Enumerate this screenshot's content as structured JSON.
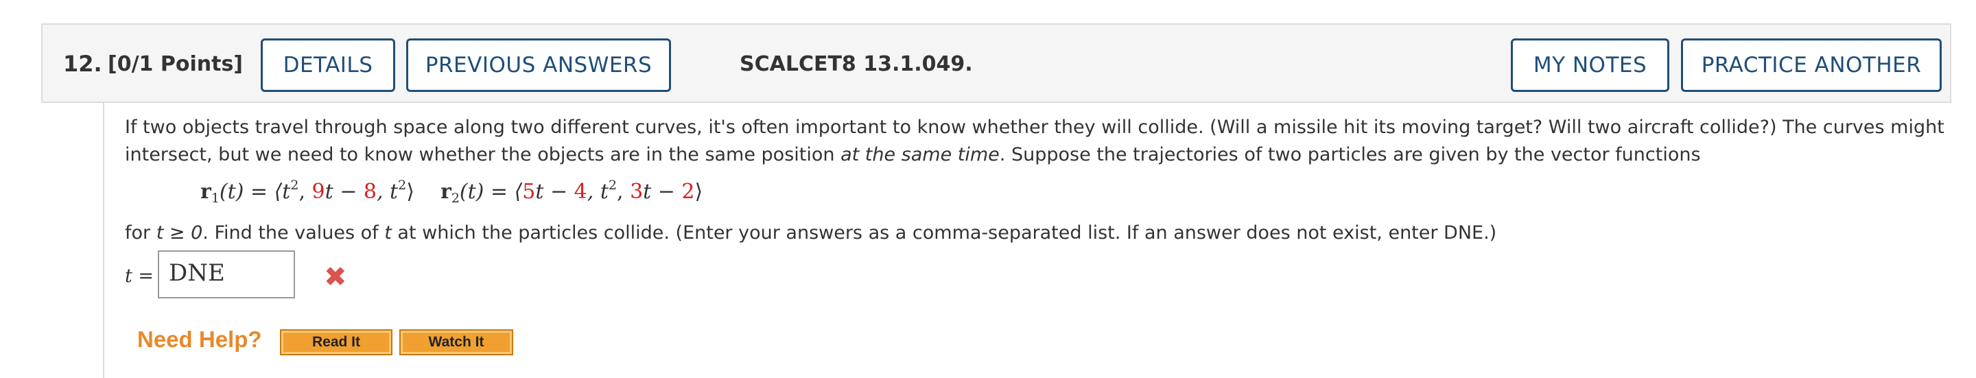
{
  "header": {
    "question_number": "12.",
    "points": "[0/1 Points]",
    "details_label": "DETAILS",
    "previous_answers_label": "PREVIOUS ANSWERS",
    "question_id": "SCALCET8 13.1.049.",
    "my_notes_label": "MY NOTES",
    "practice_another_label": "PRACTICE ANOTHER"
  },
  "question": {
    "para1_line1": "If two objects travel through space along two different curves, it's often important to know whether they will collide. (Will a missile hit its moving target? Will two aircraft collide?) The curves might",
    "para1_line2_start": "intersect, but we need to know whether the objects are in the same position ",
    "para1_line2_italic": "at the same time",
    "para1_line2_end": ". Suppose the trajectories of two particles are given by the vector functions",
    "r1": {
      "name": "r",
      "sub": "1",
      "arg": "(t) = ⟨t",
      "exp1": "2",
      "sep1": ", ",
      "red1": "9",
      "mid1": "t − ",
      "red2": "8",
      "sep2": ", t",
      "exp2": "2",
      "close": "⟩"
    },
    "r2": {
      "name": "r",
      "sub": "2",
      "arg": "(t) = ⟨",
      "red1": "5",
      "mid1": "t − ",
      "red2": "4",
      "sep1": ", t",
      "exp1": "2",
      "sep2": ", ",
      "red3": "3",
      "mid2": "t − ",
      "red4": "2",
      "close": "⟩"
    },
    "para2_for": "for  ",
    "para2_cond": "t ≥ 0",
    "para2_mid": ".  Find the values of ",
    "para2_t": "t",
    "para2_end": " at which the particles collide. (Enter your answers as a comma-separated list. If an answer does not exist, enter DNE.)"
  },
  "answer": {
    "label": "t =",
    "value": "DNE",
    "status": "incorrect",
    "status_color": "#d9534f"
  },
  "help": {
    "label": "Need Help?",
    "read_it_label": "Read It",
    "watch_it_label": "Watch It"
  },
  "colors": {
    "button_border": "#1f4e79",
    "highlight_red": "#d62020",
    "help_orange": "#e8892a"
  }
}
